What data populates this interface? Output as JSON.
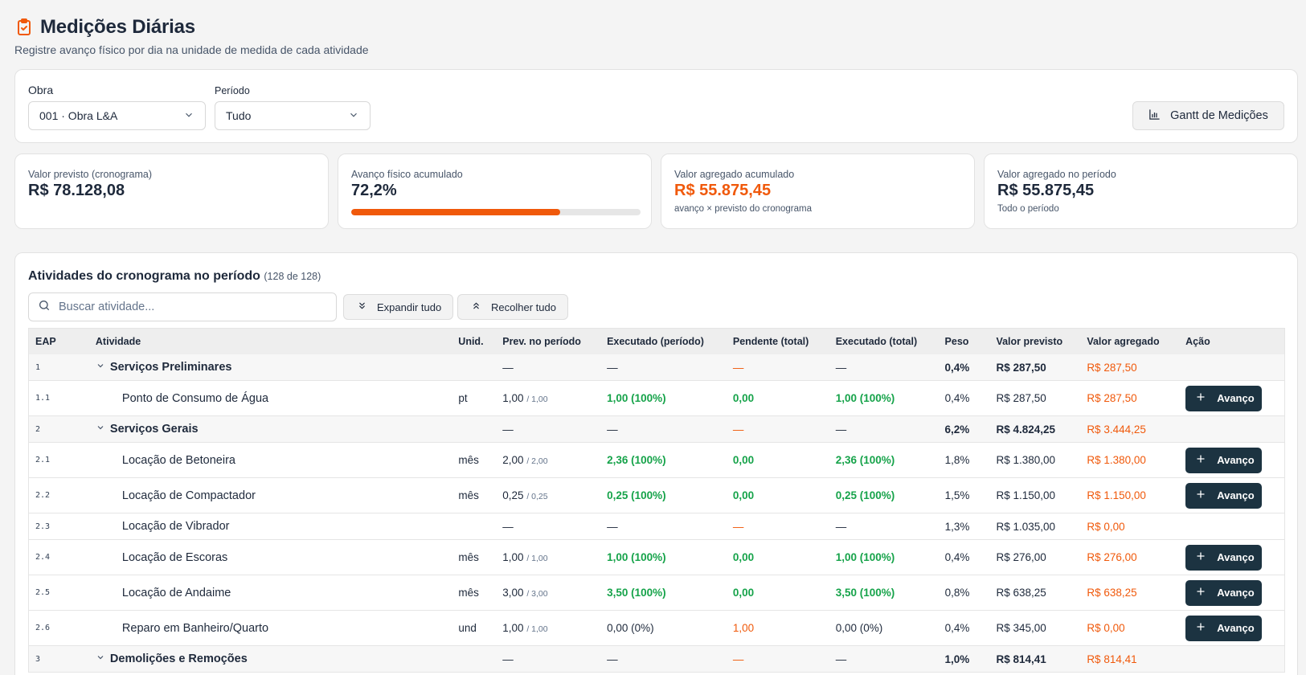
{
  "header": {
    "title": "Medições Diárias",
    "subtitle": "Registre avanço físico por dia na unidade de medida de cada atividade"
  },
  "filters": {
    "obra_label": "Obra",
    "obra_value": "001 · Obra L&A",
    "periodo_label": "Período",
    "periodo_value": "Tudo",
    "gantt_button": "Gantt de Medições"
  },
  "kpis": {
    "valor_previsto": {
      "label": "Valor previsto (cronograma)",
      "value": "R$ 78.128,08"
    },
    "avanco_fisico": {
      "label": "Avanço físico acumulado",
      "value": "72,2%",
      "progress": 0.722
    },
    "valor_agregado_acum": {
      "label": "Valor agregado acumulado",
      "value": "R$ 55.875,45",
      "note": "avanço × previsto do cronograma"
    },
    "valor_agregado_periodo": {
      "label": "Valor agregado no período",
      "value": "R$ 55.875,45",
      "note": "Todo o período"
    }
  },
  "activities": {
    "title": "Atividades do cronograma no período",
    "count": "(128 de 128)",
    "search_placeholder": "Buscar atividade...",
    "expand_all": "Expandir tudo",
    "collapse_all": "Recolher tudo",
    "columns": [
      "EAP",
      "Atividade",
      "Unid.",
      "Prev. no período",
      "Executado (período)",
      "Pendente (total)",
      "Executado (total)",
      "Peso",
      "Valor previsto",
      "Valor agregado",
      "Ação"
    ],
    "action_label": "Avanço",
    "rows": [
      {
        "type": "group",
        "eap": "1",
        "name": "Serviços Preliminares",
        "unid": "",
        "prev": "—",
        "prev_total": "",
        "exec": "—",
        "pend": "—",
        "exec_total": "—",
        "peso": "0,4%",
        "vprev": "R$ 287,50",
        "vagr": "R$ 287,50"
      },
      {
        "type": "item",
        "eap": "1.1",
        "name": "Ponto de Consumo de Água",
        "unid": "pt",
        "prev": "1,00",
        "prev_total": "/ 1,00",
        "exec": "1,00 (100%)",
        "pend": "0,00",
        "exec_total": "1,00 (100%)",
        "peso": "0,4%",
        "vprev": "R$ 287,50",
        "vagr": "R$ 287,50"
      },
      {
        "type": "group",
        "eap": "2",
        "name": "Serviços Gerais",
        "unid": "",
        "prev": "—",
        "prev_total": "",
        "exec": "—",
        "pend": "—",
        "exec_total": "—",
        "peso": "6,2%",
        "vprev": "R$ 4.824,25",
        "vagr": "R$ 3.444,25"
      },
      {
        "type": "item",
        "eap": "2.1",
        "name": "Locação de Betoneira",
        "unid": "mês",
        "prev": "2,00",
        "prev_total": "/ 2,00",
        "exec": "2,36 (100%)",
        "pend": "0,00",
        "exec_total": "2,36 (100%)",
        "peso": "1,8%",
        "vprev": "R$ 1.380,00",
        "vagr": "R$ 1.380,00"
      },
      {
        "type": "item",
        "eap": "2.2",
        "name": "Locação de Compactador",
        "unid": "mês",
        "prev": "0,25",
        "prev_total": "/ 0,25",
        "exec": "0,25 (100%)",
        "pend": "0,00",
        "exec_total": "0,25 (100%)",
        "peso": "1,5%",
        "vprev": "R$ 1.150,00",
        "vagr": "R$ 1.150,00"
      },
      {
        "type": "item-short",
        "eap": "2.3",
        "name": "Locação de Vibrador",
        "unid": "",
        "prev": "—",
        "prev_total": "",
        "exec": "—",
        "pend": "—",
        "exec_total": "—",
        "peso": "1,3%",
        "vprev": "R$ 1.035,00",
        "vagr": "R$ 0,00"
      },
      {
        "type": "item",
        "eap": "2.4",
        "name": "Locação de Escoras",
        "unid": "mês",
        "prev": "1,00",
        "prev_total": "/ 1,00",
        "exec": "1,00 (100%)",
        "pend": "0,00",
        "exec_total": "1,00 (100%)",
        "peso": "0,4%",
        "vprev": "R$ 276,00",
        "vagr": "R$ 276,00"
      },
      {
        "type": "item",
        "eap": "2.5",
        "name": "Locação de Andaime",
        "unid": "mês",
        "prev": "3,00",
        "prev_total": "/ 3,00",
        "exec": "3,50 (100%)",
        "pend": "0,00",
        "exec_total": "3,50 (100%)",
        "peso": "0,8%",
        "vprev": "R$ 638,25",
        "vagr": "R$ 638,25"
      },
      {
        "type": "item",
        "eap": "2.6",
        "name": "Reparo em Banheiro/Quarto",
        "unid": "und",
        "prev": "1,00",
        "prev_total": "/ 1,00",
        "exec": "0,00 (0%)",
        "pend": "1,00",
        "exec_total": "0,00 (0%)",
        "peso": "0,4%",
        "vprev": "R$ 345,00",
        "vagr": "R$ 0,00"
      },
      {
        "type": "group",
        "eap": "3",
        "name": "Demolições e Remoções",
        "unid": "",
        "prev": "—",
        "prev_total": "",
        "exec": "—",
        "pend": "—",
        "exec_total": "—",
        "peso": "1,0%",
        "vprev": "R$ 814,41",
        "vagr": "R$ 814,41"
      }
    ]
  },
  "colors": {
    "accent": "#f0590b",
    "success": "#16a34a",
    "button_dark": "#1c3341"
  },
  "icons": [
    "clipboard-check-icon",
    "chevron-down-icon",
    "bar-chart-icon",
    "search-icon",
    "chevrons-down-icon",
    "chevrons-up-icon",
    "plus-icon"
  ]
}
